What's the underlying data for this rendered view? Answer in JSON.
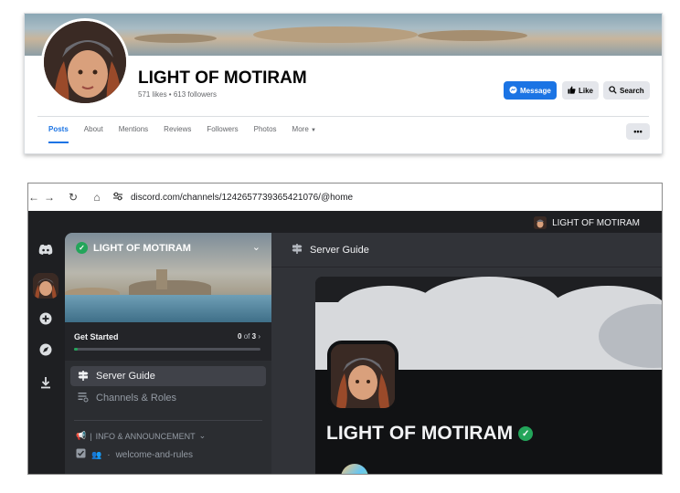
{
  "facebook": {
    "page_name": "LIGHT OF MOTIRAM",
    "stats": "571 likes • 613 followers",
    "buttons": {
      "message": "Message",
      "like": "Like",
      "search": "Search"
    },
    "tabs": [
      "Posts",
      "About",
      "Mentions",
      "Reviews",
      "Followers",
      "Photos",
      "More"
    ],
    "active_tab": "Posts",
    "more_menu": "•••",
    "accent_color": "#1b74e4"
  },
  "browser": {
    "url": "discord.com/channels/1242657739365421076/@home",
    "icons": [
      "back-arrow-icon",
      "forward-arrow-icon",
      "reload-icon",
      "home-icon",
      "site-settings-icon"
    ]
  },
  "discord": {
    "title_bar": "LIGHT OF MOTIRAM",
    "server": {
      "name": "LIGHT OF MOTIRAM",
      "verified": true
    },
    "get_started": {
      "label": "Get Started",
      "done": "0",
      "of_text": "of",
      "total": "3",
      "progress": 0.0
    },
    "nav": [
      {
        "label": "Server Guide",
        "active": true,
        "icon": "signpost-icon"
      },
      {
        "label": "Channels & Roles",
        "active": false,
        "icon": "channels-list-icon"
      }
    ],
    "category": "INFO & ANNOUNCEMENT",
    "channel": "welcome-and-rules",
    "main_header": "Server Guide",
    "main_title": "LIGHT OF MOTIRAM",
    "colors": {
      "verified": "#23a55a",
      "background": "#1e1f22",
      "sidebar": "#2b2d31"
    }
  }
}
